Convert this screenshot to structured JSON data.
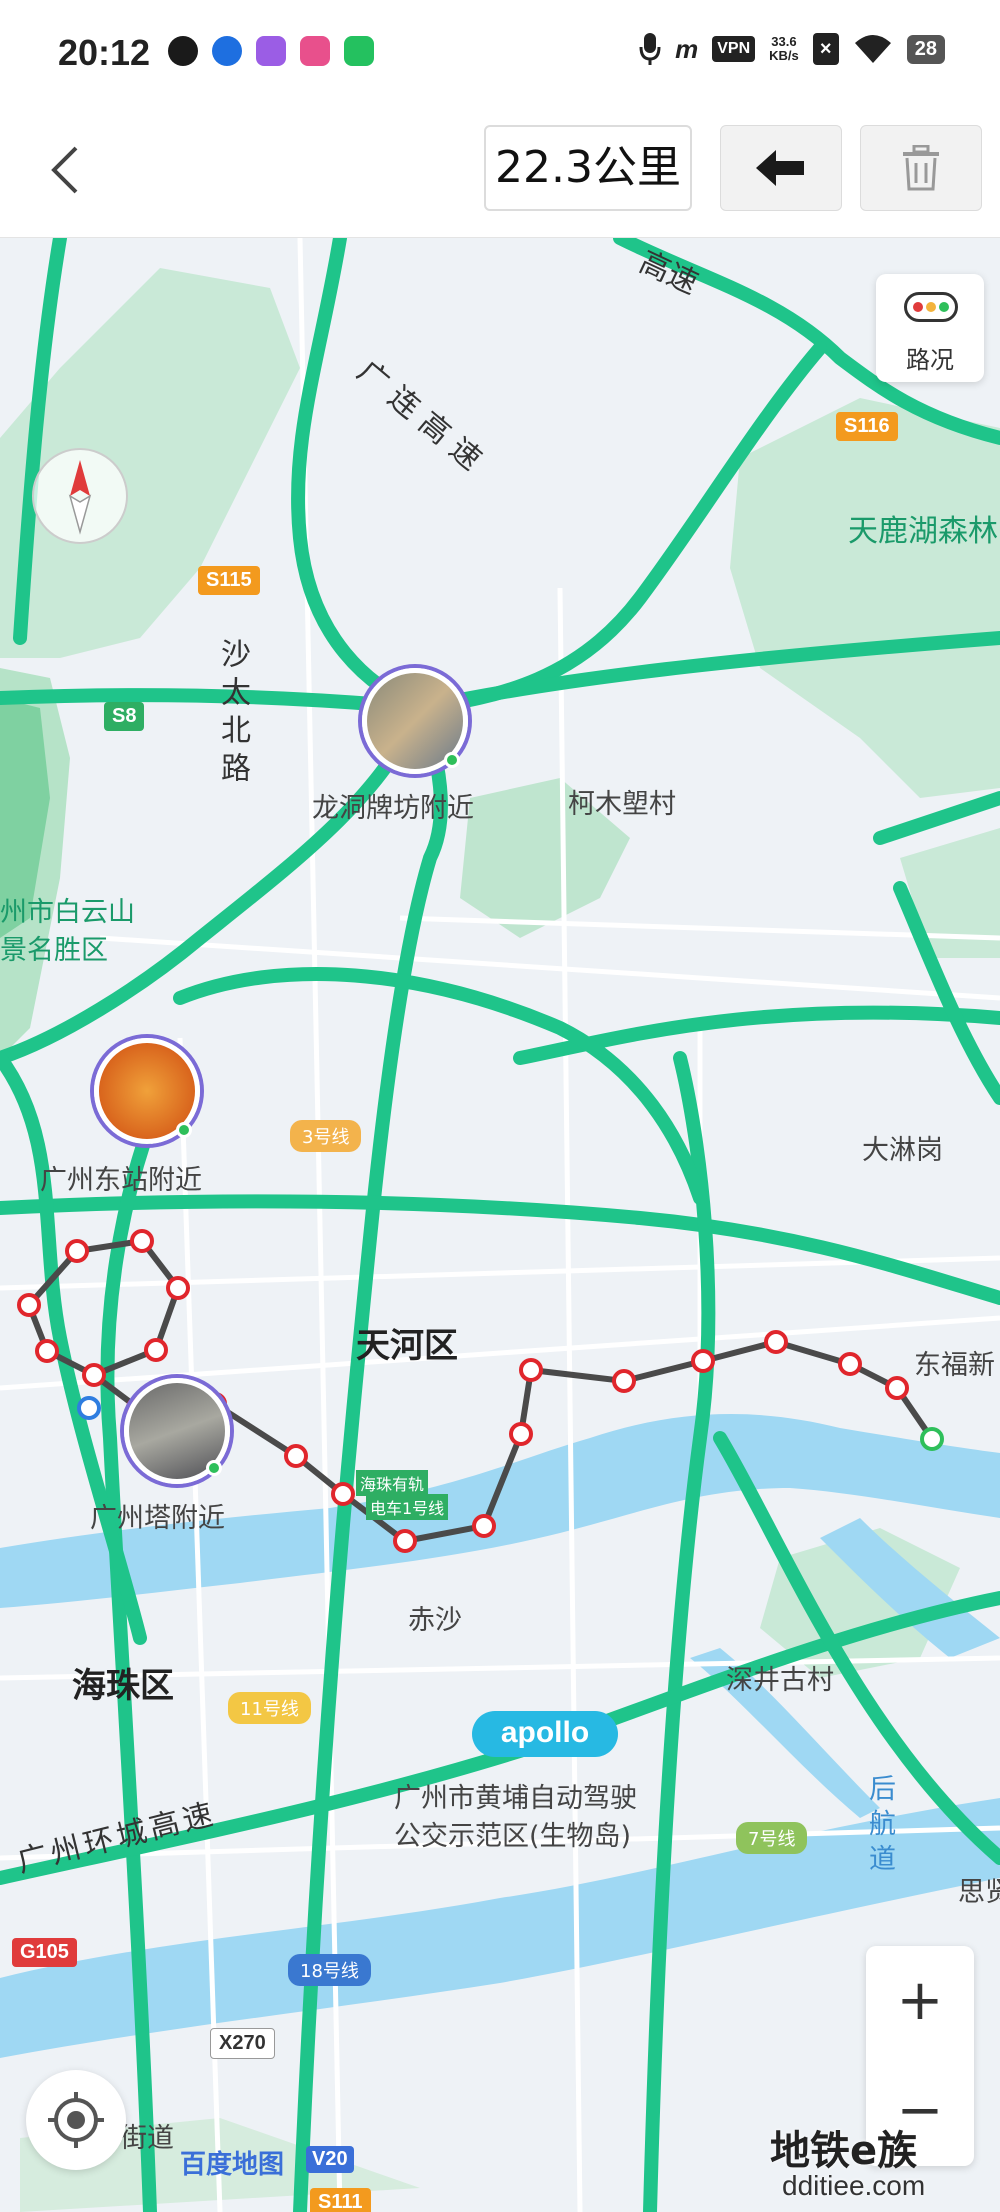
{
  "status_bar": {
    "time": "20:12",
    "vpn": "VPN",
    "speed_value": "33.6",
    "speed_unit": "KB/s",
    "battery": "28",
    "signal_brand": "m"
  },
  "toolbar": {
    "distance": "22.3公里"
  },
  "map": {
    "traffic_label": "路况",
    "labels": {
      "guanglian_expressway": "广连高速",
      "top_expressway": "高速",
      "tianlu_lake": "天鹿湖森林",
      "shatai_north_road": "沙太北路",
      "longdong": "龙洞牌坊附近",
      "kemushuo": "柯木塱村",
      "baiyun_mountain_1": "州市白云山",
      "baiyun_mountain_2": "景名胜区",
      "guangzhou_east": "广州东站附近",
      "dalinggang": "大淋岗",
      "tianhe": "天河区",
      "dongfu": "东福新",
      "canton_tower": "广州塔附近",
      "chisha": "赤沙",
      "haizhu": "海珠区",
      "shenjing": "深井古村",
      "huangpu_1": "广州市黄埔自动驾驶",
      "huangpu_2": "公交示范区(生物岛)",
      "ring_expressway": "广州环城高速",
      "houhang": "后航道",
      "sijia": "思贤",
      "jiedao": "街道",
      "tram_1": "海珠有轨",
      "tram_2": "电车1号线"
    },
    "shields": {
      "s116": "S116",
      "s115": "S115",
      "s8": "S8",
      "g105": "G105",
      "x270": "X270",
      "s111": "S111"
    },
    "metro": {
      "line3": "3号线",
      "line11": "11号线",
      "line7": "7号线",
      "line18": "18号线"
    },
    "apollo": "apollo",
    "logo": "百度地图",
    "logo_version": "V20",
    "zoom_in": "+",
    "zoom_out": "−",
    "watermark": "地铁e族",
    "watermark_url": "dditiee.com"
  }
}
